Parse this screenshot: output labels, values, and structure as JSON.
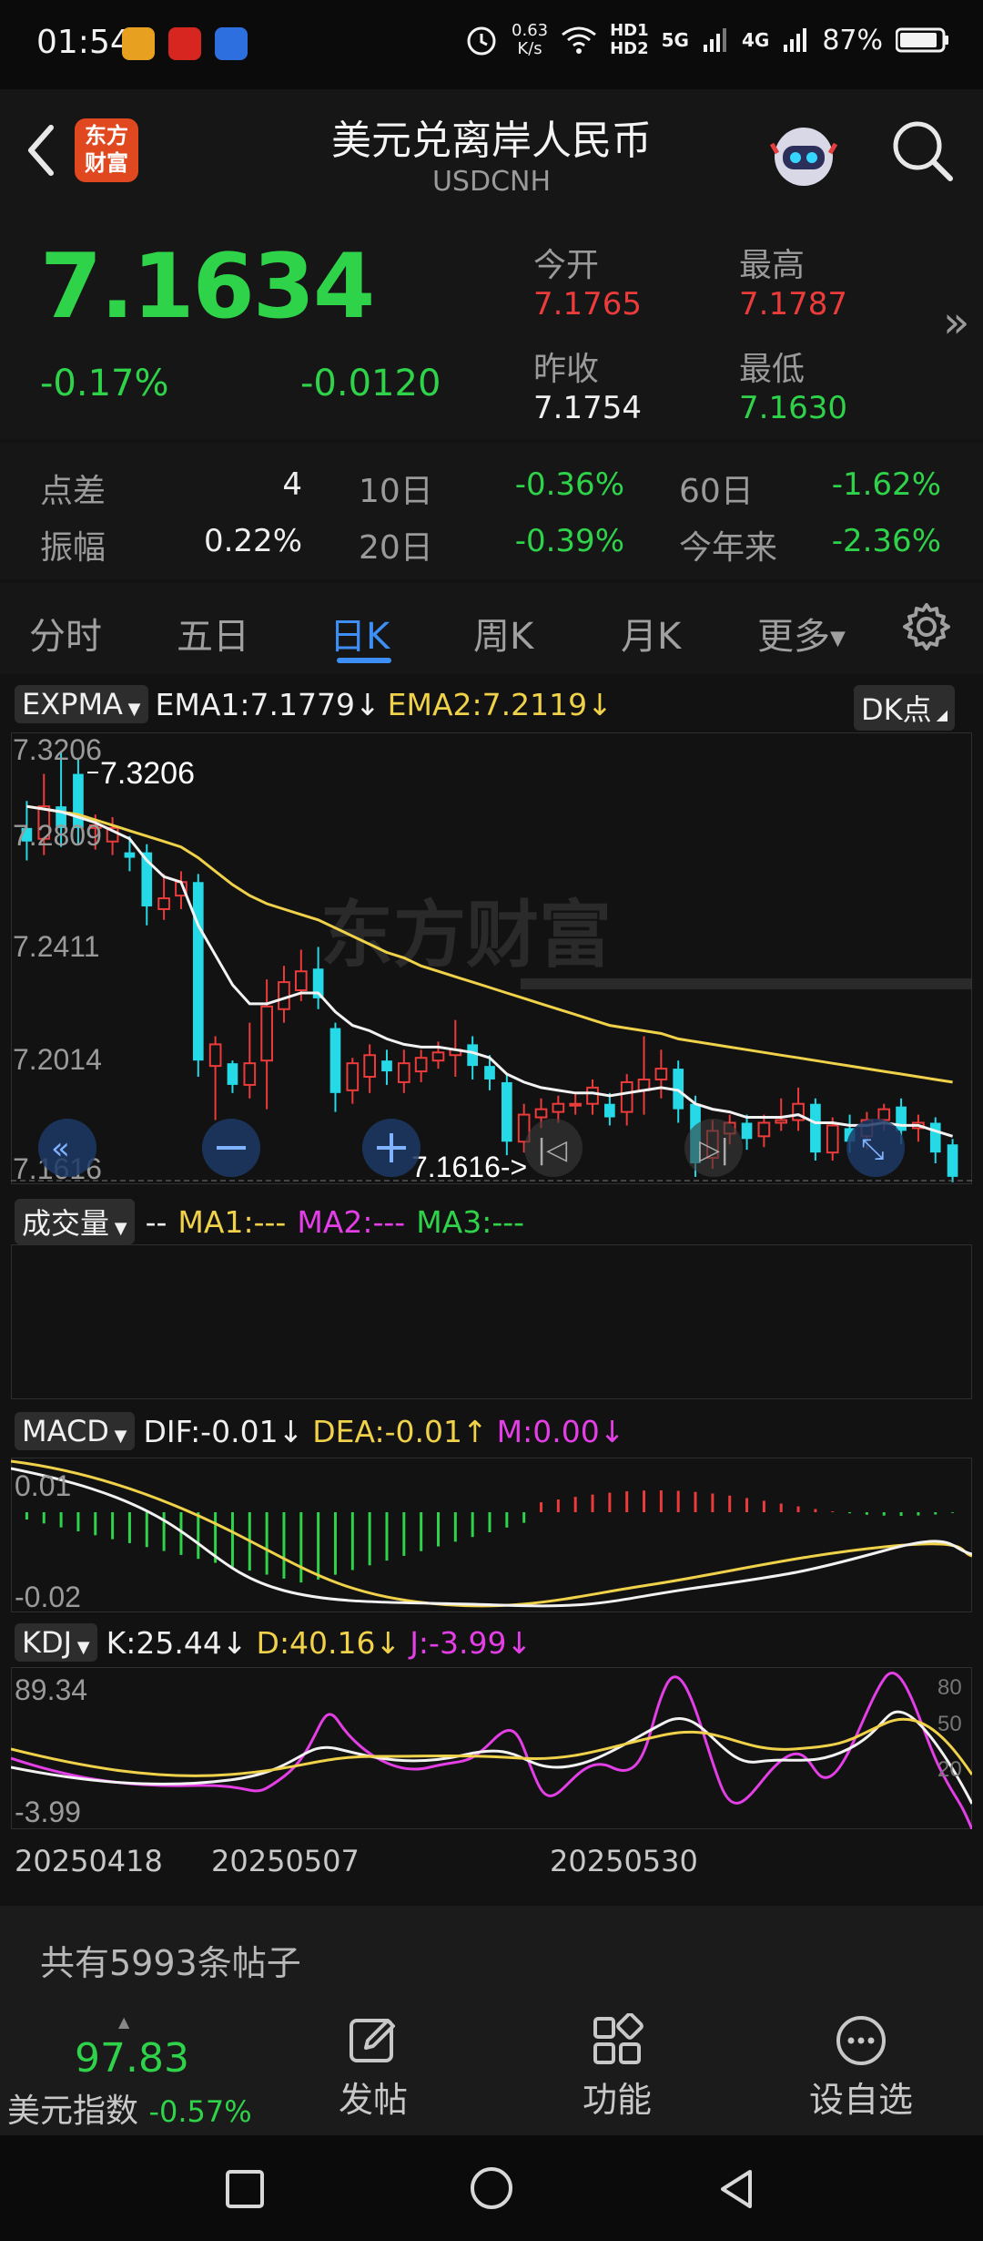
{
  "status_bar": {
    "time": "01:54",
    "net_speed_top": "0.63",
    "net_speed_unit": "K/s",
    "hd1": "HD1",
    "hd2": "HD2",
    "sig1": "5G",
    "sig2": "4G",
    "battery": "87%"
  },
  "header": {
    "back_icon": "chevron-left-icon",
    "logo_text_1": "东方",
    "logo_text_2": "财富",
    "title": "美元兑离岸人民币",
    "subtitle": "USDCNH"
  },
  "quote": {
    "price": "7.1634",
    "change_pct": "-0.17%",
    "change": "-0.0120",
    "open_label": "今开",
    "open": "7.1765",
    "high_label": "最高",
    "high": "7.1787",
    "prev_close_label": "昨收",
    "prev_close": "7.1754",
    "low_label": "最低",
    "low": "7.1630",
    "more": "»"
  },
  "stats": {
    "spread_label": "点差",
    "spread": "4",
    "d10_label": "10日",
    "d10": "-0.36%",
    "d60_label": "60日",
    "d60": "-1.62%",
    "amp_label": "振幅",
    "amp": "0.22%",
    "d20_label": "20日",
    "d20": "-0.39%",
    "ytd_label": "今年来",
    "ytd": "-2.36%"
  },
  "tabs": [
    "分时",
    "五日",
    "日K",
    "周K",
    "月K",
    "更多"
  ],
  "active_tab": 2,
  "chart": {
    "main_indicator": "EXPMA",
    "ema1": "EMA1:7.1779",
    "ema2": "EMA2:7.2119",
    "dk_button": "DK点",
    "y_labels": [
      "7.3206",
      "7.2809",
      "7.2411",
      "7.2014",
      "7.1616"
    ],
    "max_marker": "7.3206",
    "min_marker": "7.1616->",
    "watermark": "东方财富",
    "volume_indicator": "成交量",
    "vol_dashes": "--",
    "ma1": "MA1:---",
    "ma2": "MA2:---",
    "ma3": "MA3:---",
    "macd_indicator": "MACD",
    "dif": "DIF:-0.01",
    "dea": "DEA:-0.01",
    "m": "M:0.00",
    "macd_top": "0.01",
    "macd_bottom": "-0.02",
    "kdj_indicator": "KDJ",
    "k": "K:25.44",
    "d": "D:40.16",
    "j": "J:-3.99",
    "kdj_top": "89.34",
    "kdj_bottom": "-3.99",
    "kdj_levels": [
      "80",
      "50",
      "20"
    ],
    "dates": [
      "20250418",
      "20250507",
      "20250530"
    ],
    "colors": {
      "up": "#ec3b3b",
      "down": "#25d9e6",
      "ema1": "#f2f2f2",
      "ema2": "#f0d24a",
      "dif": "#f2f2f2",
      "dea": "#f0d24a",
      "k": "#f2f2f2",
      "d": "#f0d24a",
      "j": "#e43fe6"
    }
  },
  "posts": {
    "text": "共有5993条帖子"
  },
  "bottom_nav": {
    "index_value": "97.83",
    "index_name": "美元指数",
    "index_change": "-0.57%",
    "post": "发帖",
    "func": "功能",
    "watch": "设自选"
  },
  "chart_data": {
    "type": "candlestick",
    "series": [
      {
        "o": 7.292,
        "c": 7.287,
        "h": 7.302,
        "l": 7.28
      },
      {
        "o": 7.288,
        "c": 7.3,
        "h": 7.312,
        "l": 7.282
      },
      {
        "o": 7.3,
        "c": 7.292,
        "h": 7.32,
        "l": 7.285
      },
      {
        "o": 7.312,
        "c": 7.292,
        "h": 7.318,
        "l": 7.286
      },
      {
        "o": 7.292,
        "c": 7.293,
        "h": 7.297,
        "l": 7.284
      },
      {
        "o": 7.287,
        "c": 7.292,
        "h": 7.296,
        "l": 7.282
      },
      {
        "o": 7.283,
        "c": 7.281,
        "h": 7.289,
        "l": 7.276
      },
      {
        "o": 7.283,
        "c": 7.263,
        "h": 7.286,
        "l": 7.256
      },
      {
        "o": 7.262,
        "c": 7.266,
        "h": 7.275,
        "l": 7.258
      },
      {
        "o": 7.267,
        "c": 7.272,
        "h": 7.276,
        "l": 7.262
      },
      {
        "o": 7.272,
        "c": 7.206,
        "h": 7.275,
        "l": 7.2
      },
      {
        "o": 7.204,
        "c": 7.212,
        "h": 7.215,
        "l": 7.184
      },
      {
        "o": 7.205,
        "c": 7.197,
        "h": 7.206,
        "l": 7.194
      },
      {
        "o": 7.197,
        "c": 7.205,
        "h": 7.22,
        "l": 7.192
      },
      {
        "o": 7.206,
        "c": 7.226,
        "h": 7.236,
        "l": 7.188
      },
      {
        "o": 7.225,
        "c": 7.235,
        "h": 7.241,
        "l": 7.22
      },
      {
        "o": 7.232,
        "c": 7.239,
        "h": 7.247,
        "l": 7.228
      },
      {
        "o": 7.24,
        "c": 7.229,
        "h": 7.248,
        "l": 7.225
      },
      {
        "o": 7.218,
        "c": 7.194,
        "h": 7.22,
        "l": 7.187
      },
      {
        "o": 7.195,
        "c": 7.205,
        "h": 7.207,
        "l": 7.19
      },
      {
        "o": 7.2,
        "c": 7.208,
        "h": 7.212,
        "l": 7.194
      },
      {
        "o": 7.206,
        "c": 7.202,
        "h": 7.21,
        "l": 7.197
      },
      {
        "o": 7.198,
        "c": 7.205,
        "h": 7.21,
        "l": 7.194
      },
      {
        "o": 7.202,
        "c": 7.207,
        "h": 7.21,
        "l": 7.198
      },
      {
        "o": 7.206,
        "c": 7.209,
        "h": 7.213,
        "l": 7.203
      },
      {
        "o": 7.208,
        "c": 7.21,
        "h": 7.221,
        "l": 7.2
      },
      {
        "o": 7.212,
        "c": 7.204,
        "h": 7.215,
        "l": 7.199
      },
      {
        "o": 7.204,
        "c": 7.199,
        "h": 7.208,
        "l": 7.195
      },
      {
        "o": 7.198,
        "c": 7.176,
        "h": 7.201,
        "l": 7.171
      },
      {
        "o": 7.176,
        "c": 7.186,
        "h": 7.19,
        "l": 7.172
      },
      {
        "o": 7.185,
        "c": 7.188,
        "h": 7.192,
        "l": 7.181
      },
      {
        "o": 7.187,
        "c": 7.19,
        "h": 7.193,
        "l": 7.183
      },
      {
        "o": 7.19,
        "c": 7.19,
        "h": 7.194,
        "l": 7.186
      },
      {
        "o": 7.19,
        "c": 7.196,
        "h": 7.199,
        "l": 7.186
      },
      {
        "o": 7.19,
        "c": 7.185,
        "h": 7.194,
        "l": 7.182
      },
      {
        "o": 7.187,
        "c": 7.198,
        "h": 7.201,
        "l": 7.182
      },
      {
        "o": 7.195,
        "c": 7.199,
        "h": 7.215,
        "l": 7.186
      },
      {
        "o": 7.199,
        "c": 7.203,
        "h": 7.21,
        "l": 7.192
      },
      {
        "o": 7.203,
        "c": 7.188,
        "h": 7.206,
        "l": 7.183
      },
      {
        "o": 7.19,
        "c": 7.168,
        "h": 7.193,
        "l": 7.163
      },
      {
        "o": 7.17,
        "c": 7.18,
        "h": 7.184,
        "l": 7.166
      },
      {
        "o": 7.179,
        "c": 7.183,
        "h": 7.186,
        "l": 7.175
      },
      {
        "o": 7.183,
        "c": 7.177,
        "h": 7.186,
        "l": 7.173
      },
      {
        "o": 7.178,
        "c": 7.183,
        "h": 7.186,
        "l": 7.174
      },
      {
        "o": 7.183,
        "c": 7.184,
        "h": 7.192,
        "l": 7.18
      },
      {
        "o": 7.184,
        "c": 7.19,
        "h": 7.196,
        "l": 7.18
      },
      {
        "o": 7.19,
        "c": 7.172,
        "h": 7.192,
        "l": 7.169
      },
      {
        "o": 7.172,
        "c": 7.182,
        "h": 7.185,
        "l": 7.169
      },
      {
        "o": 7.181,
        "c": 7.176,
        "h": 7.186,
        "l": 7.172
      },
      {
        "o": 7.178,
        "c": 7.184,
        "h": 7.187,
        "l": 7.173
      },
      {
        "o": 7.184,
        "c": 7.188,
        "h": 7.19,
        "l": 7.18
      },
      {
        "o": 7.189,
        "c": 7.18,
        "h": 7.192,
        "l": 7.175
      },
      {
        "o": 7.181,
        "c": 7.183,
        "h": 7.186,
        "l": 7.176
      },
      {
        "o": 7.183,
        "c": 7.172,
        "h": 7.185,
        "l": 7.168
      },
      {
        "o": 7.175,
        "c": 7.163,
        "h": 7.177,
        "l": 7.161
      }
    ],
    "ema1": [
      7.3,
      7.299,
      7.298,
      7.296,
      7.294,
      7.291,
      7.288,
      7.28,
      7.274,
      7.272,
      7.256,
      7.245,
      7.234,
      7.227,
      7.227,
      7.229,
      7.231,
      7.231,
      7.224,
      7.219,
      7.217,
      7.214,
      7.212,
      7.211,
      7.211,
      7.21,
      7.209,
      7.207,
      7.201,
      7.198,
      7.196,
      7.195,
      7.194,
      7.194,
      7.193,
      7.194,
      7.195,
      7.196,
      7.195,
      7.19,
      7.188,
      7.187,
      7.185,
      7.185,
      7.185,
      7.186,
      7.183,
      7.183,
      7.182,
      7.182,
      7.183,
      7.182,
      7.182,
      7.18,
      7.178
    ],
    "ema2": [
      7.3,
      7.299,
      7.298,
      7.297,
      7.295,
      7.293,
      7.291,
      7.289,
      7.287,
      7.285,
      7.281,
      7.276,
      7.271,
      7.267,
      7.264,
      7.262,
      7.26,
      7.258,
      7.255,
      7.252,
      7.249,
      7.246,
      7.244,
      7.241,
      7.239,
      7.237,
      7.235,
      7.233,
      7.231,
      7.229,
      7.227,
      7.225,
      7.223,
      7.221,
      7.219,
      7.218,
      7.217,
      7.216,
      7.214,
      7.213,
      7.212,
      7.211,
      7.21,
      7.209,
      7.208,
      7.207,
      7.206,
      7.205,
      7.204,
      7.203,
      7.202,
      7.201,
      7.2,
      7.199,
      7.198
    ],
    "ylim": [
      7.1616,
      7.3206
    ]
  }
}
